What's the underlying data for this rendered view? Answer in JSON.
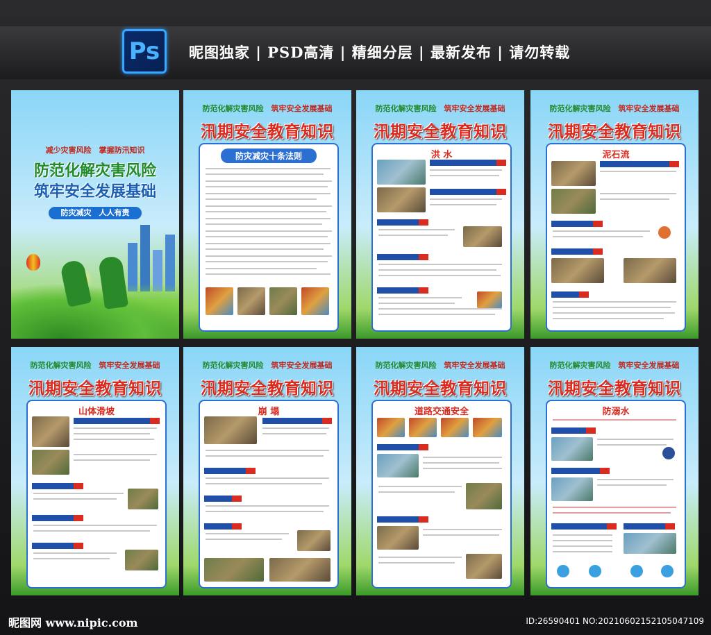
{
  "header": {
    "ps_logo": "Ps",
    "tagline": "昵图独家 | PSD高清 | 精细分层 | 最新发布 | 请勿转载"
  },
  "common": {
    "slogan_a": "防范化解灾害风险",
    "slogan_b": "筑牢安全发展基础",
    "main_title": "汛期安全教育知识"
  },
  "cover": {
    "sub": "减少灾害风险　掌握防汛知识",
    "title_1": "防范化解灾害风险",
    "title_2": "筑牢安全发展基础",
    "pill": "防灾减灾　人人有责"
  },
  "panels": {
    "p2": "防灾减灾十条法则",
    "p3": "洪 水",
    "p4": "泥石流",
    "p5": "山体滑坡",
    "p6": "崩 塌",
    "p7": "道路交通安全",
    "p8": "防溺水"
  },
  "footer": {
    "left": "昵图网 www.nipic.com",
    "right": "ID:26590401 NO:20210602152105047109"
  },
  "colors": {
    "accent_red": "#d92b20",
    "accent_blue": "#1f4fa8",
    "accent_green": "#1f8a2a"
  }
}
